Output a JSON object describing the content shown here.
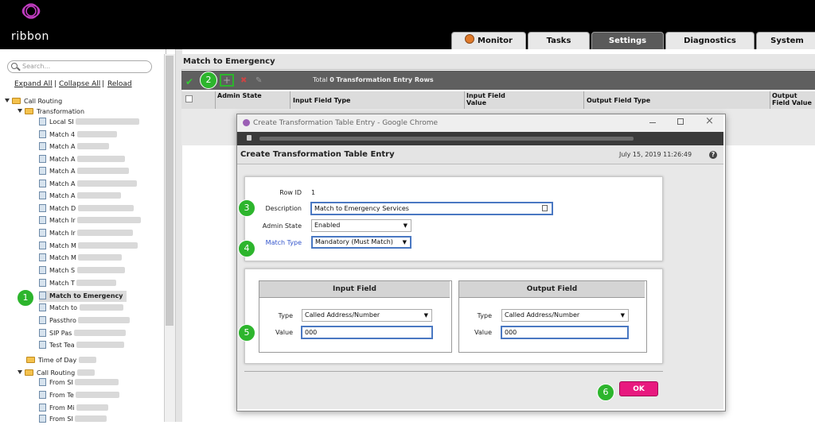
{
  "brand": {
    "logo_text": "ribbon",
    "logo_color": "#c03cc0"
  },
  "top_tabs": [
    {
      "label": "Monitor"
    },
    {
      "label": "Tasks"
    },
    {
      "label": "Settings"
    },
    {
      "label": "Diagnostics"
    },
    {
      "label": "System"
    }
  ],
  "sidebar": {
    "search_placeholder": "Search...",
    "links": [
      "Expand All",
      "Collapse All",
      "Reload"
    ],
    "tree": [
      {
        "label": "Call Routing",
        "kind": "folder"
      },
      {
        "label": "Transformation",
        "kind": "folder"
      },
      {
        "label": "Local SI",
        "kind": "doc"
      },
      {
        "label": "Match 4",
        "kind": "doc"
      },
      {
        "label": "Match A",
        "kind": "doc"
      },
      {
        "label": "Match A",
        "kind": "doc"
      },
      {
        "label": "Match A",
        "kind": "doc"
      },
      {
        "label": "Match A",
        "kind": "doc"
      },
      {
        "label": "Match A",
        "kind": "doc"
      },
      {
        "label": "Match D",
        "kind": "doc"
      },
      {
        "label": "Match Ir",
        "kind": "doc"
      },
      {
        "label": "Match Ir",
        "kind": "doc"
      },
      {
        "label": "Match M",
        "kind": "doc"
      },
      {
        "label": "Match M",
        "kind": "doc"
      },
      {
        "label": "Match S",
        "kind": "doc"
      },
      {
        "label": "Match T",
        "kind": "doc"
      },
      {
        "label": "Match to Emergency",
        "kind": "doc",
        "selected": true
      },
      {
        "label": "Match to",
        "kind": "doc"
      },
      {
        "label": "Passthro",
        "kind": "doc"
      },
      {
        "label": "SIP Pas",
        "kind": "doc"
      },
      {
        "label": "Test Tea",
        "kind": "doc"
      },
      {
        "label": "Time of Day",
        "kind": "folder"
      },
      {
        "label": "Call Routing",
        "kind": "folder"
      },
      {
        "label": "From SI",
        "kind": "doc"
      },
      {
        "label": "From Te",
        "kind": "doc"
      },
      {
        "label": "From Mi",
        "kind": "doc"
      },
      {
        "label": "From SI",
        "kind": "doc"
      }
    ]
  },
  "main": {
    "title": "Match to Emergency",
    "toolbar": {
      "total_prefix": "Total",
      "total_count": "0",
      "total_suffix": "Transformation Entry Rows"
    },
    "columns": [
      "Admin State",
      "Input Field Type",
      "Input Field Value",
      "Output Field Type",
      "Output Field Value"
    ]
  },
  "popup": {
    "window_title": "Create Transformation Table Entry - Google Chrome",
    "header_title": "Create Transformation Table Entry",
    "date": "July 15, 2019 11:26:49",
    "help": "?",
    "row_id_label": "Row ID",
    "row_id_value": "1",
    "description_label": "Description",
    "description_value": "Match to Emergency Services",
    "admin_state_label": "Admin State",
    "admin_state_value": "Enabled",
    "match_type_label": "Match Type",
    "match_type_value": "Mandatory (Must Match)",
    "input_field": {
      "title": "Input Field",
      "type_label": "Type",
      "type_value": "Called Address/Number",
      "value_label": "Value",
      "value": "000"
    },
    "output_field": {
      "title": "Output Field",
      "type_label": "Type",
      "type_value": "Called Address/Number",
      "value_label": "Value",
      "value": "000"
    },
    "ok_label": "OK"
  },
  "markers": [
    "1",
    "2",
    "3",
    "4",
    "5",
    "6"
  ],
  "colors": {
    "ok": "#e8197f",
    "marker": "#2db52d",
    "match_type_label": "#3355cc"
  }
}
